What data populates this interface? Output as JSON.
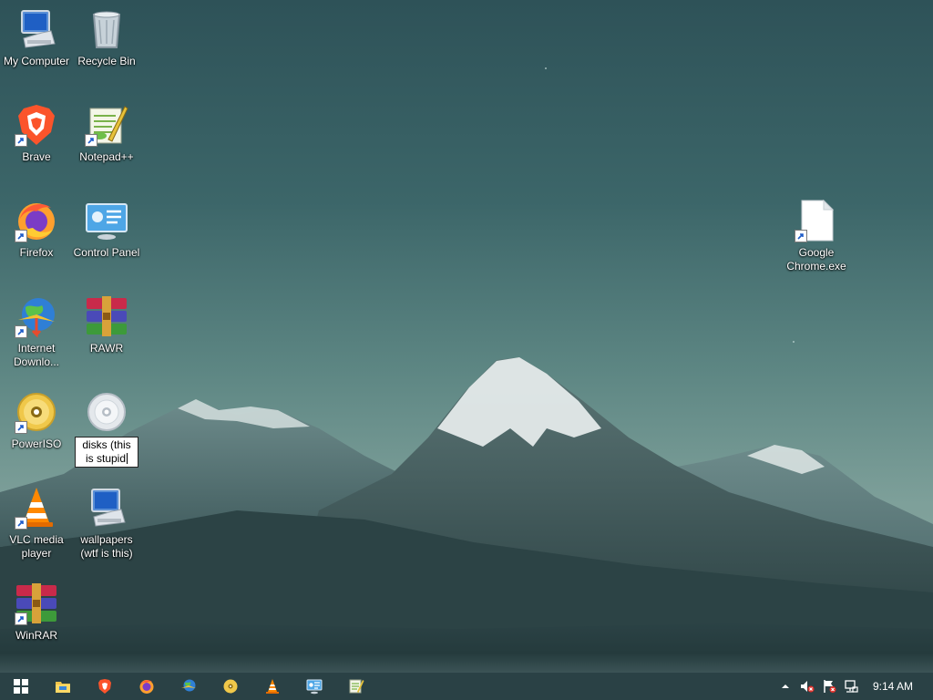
{
  "desktop": {
    "icons": [
      {
        "id": "my-computer",
        "label": "My Computer",
        "icon": "monitor-icon",
        "shortcut": false
      },
      {
        "id": "recycle-bin",
        "label": "Recycle Bin",
        "icon": "trash-icon",
        "shortcut": false
      },
      {
        "id": "brave",
        "label": "Brave",
        "icon": "brave-icon",
        "shortcut": true
      },
      {
        "id": "notepadpp",
        "label": "Notepad++",
        "icon": "notepadpp-icon",
        "shortcut": true
      },
      {
        "id": "firefox",
        "label": "Firefox",
        "icon": "firefox-icon",
        "shortcut": true
      },
      {
        "id": "control-panel",
        "label": "Control Panel",
        "icon": "control-panel-icon",
        "shortcut": false
      },
      {
        "id": "internet-download",
        "label": "Internet Downlo...",
        "icon": "idm-icon",
        "shortcut": true
      },
      {
        "id": "rawr",
        "label": "RAWR",
        "icon": "winrar-icon",
        "shortcut": false
      },
      {
        "id": "poweriso",
        "label": "PowerISO",
        "icon": "disc-icon",
        "shortcut": true
      },
      {
        "id": "disks",
        "label": "disks (this is stupid",
        "icon": "blank-disc-icon",
        "shortcut": false,
        "renaming": true
      },
      {
        "id": "vlc",
        "label": "VLC media player",
        "icon": "vlc-icon",
        "shortcut": true
      },
      {
        "id": "wallpapers",
        "label": "wallpapers (wtf is this)",
        "icon": "monitor-icon",
        "shortcut": false
      },
      {
        "id": "winrar",
        "label": "WinRAR",
        "icon": "winrar-icon",
        "shortcut": true
      },
      {
        "id": "google-chrome-exe",
        "label": "Google Chrome.exe",
        "icon": "file-icon",
        "shortcut": true
      }
    ]
  },
  "taskbar": {
    "start": "windows-icon",
    "pinned": [
      "file-explorer-icon",
      "brave-icon",
      "firefox-icon",
      "idm-icon",
      "poweriso-icon",
      "vlc-icon",
      "control-panel-icon",
      "notepadpp-icon"
    ],
    "tray": [
      "chevron-up-icon",
      "volume-muted-icon",
      "flag-error-icon",
      "network-icon"
    ],
    "clock": "9:14 AM"
  },
  "colors": {
    "taskbar": "#2a4145",
    "sky_top": "#2e5258",
    "sky_bottom": "#8fa9a2"
  }
}
